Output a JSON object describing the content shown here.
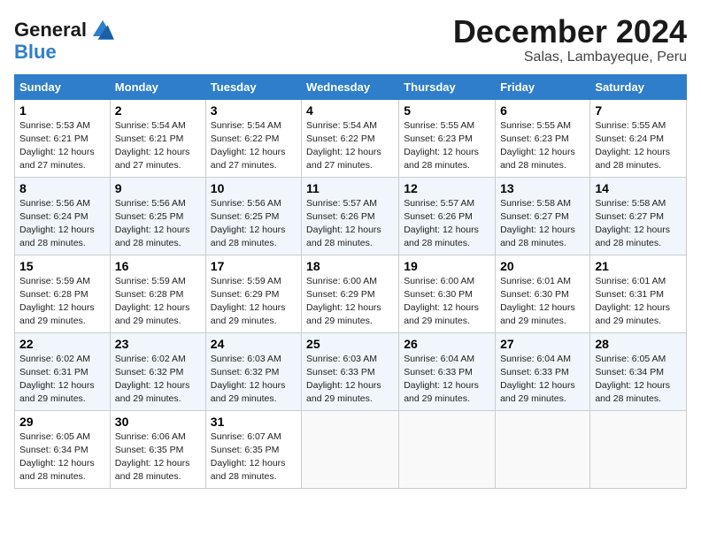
{
  "logo": {
    "line1": "General",
    "line2": "Blue"
  },
  "title": "December 2024",
  "location": "Salas, Lambayeque, Peru",
  "days_of_week": [
    "Sunday",
    "Monday",
    "Tuesday",
    "Wednesday",
    "Thursday",
    "Friday",
    "Saturday"
  ],
  "weeks": [
    [
      {
        "day": "1",
        "text": "Sunrise: 5:53 AM\nSunset: 6:21 PM\nDaylight: 12 hours\nand 27 minutes."
      },
      {
        "day": "2",
        "text": "Sunrise: 5:54 AM\nSunset: 6:21 PM\nDaylight: 12 hours\nand 27 minutes."
      },
      {
        "day": "3",
        "text": "Sunrise: 5:54 AM\nSunset: 6:22 PM\nDaylight: 12 hours\nand 27 minutes."
      },
      {
        "day": "4",
        "text": "Sunrise: 5:54 AM\nSunset: 6:22 PM\nDaylight: 12 hours\nand 27 minutes."
      },
      {
        "day": "5",
        "text": "Sunrise: 5:55 AM\nSunset: 6:23 PM\nDaylight: 12 hours\nand 28 minutes."
      },
      {
        "day": "6",
        "text": "Sunrise: 5:55 AM\nSunset: 6:23 PM\nDaylight: 12 hours\nand 28 minutes."
      },
      {
        "day": "7",
        "text": "Sunrise: 5:55 AM\nSunset: 6:24 PM\nDaylight: 12 hours\nand 28 minutes."
      }
    ],
    [
      {
        "day": "8",
        "text": "Sunrise: 5:56 AM\nSunset: 6:24 PM\nDaylight: 12 hours\nand 28 minutes."
      },
      {
        "day": "9",
        "text": "Sunrise: 5:56 AM\nSunset: 6:25 PM\nDaylight: 12 hours\nand 28 minutes."
      },
      {
        "day": "10",
        "text": "Sunrise: 5:56 AM\nSunset: 6:25 PM\nDaylight: 12 hours\nand 28 minutes."
      },
      {
        "day": "11",
        "text": "Sunrise: 5:57 AM\nSunset: 6:26 PM\nDaylight: 12 hours\nand 28 minutes."
      },
      {
        "day": "12",
        "text": "Sunrise: 5:57 AM\nSunset: 6:26 PM\nDaylight: 12 hours\nand 28 minutes."
      },
      {
        "day": "13",
        "text": "Sunrise: 5:58 AM\nSunset: 6:27 PM\nDaylight: 12 hours\nand 28 minutes."
      },
      {
        "day": "14",
        "text": "Sunrise: 5:58 AM\nSunset: 6:27 PM\nDaylight: 12 hours\nand 28 minutes."
      }
    ],
    [
      {
        "day": "15",
        "text": "Sunrise: 5:59 AM\nSunset: 6:28 PM\nDaylight: 12 hours\nand 29 minutes."
      },
      {
        "day": "16",
        "text": "Sunrise: 5:59 AM\nSunset: 6:28 PM\nDaylight: 12 hours\nand 29 minutes."
      },
      {
        "day": "17",
        "text": "Sunrise: 5:59 AM\nSunset: 6:29 PM\nDaylight: 12 hours\nand 29 minutes."
      },
      {
        "day": "18",
        "text": "Sunrise: 6:00 AM\nSunset: 6:29 PM\nDaylight: 12 hours\nand 29 minutes."
      },
      {
        "day": "19",
        "text": "Sunrise: 6:00 AM\nSunset: 6:30 PM\nDaylight: 12 hours\nand 29 minutes."
      },
      {
        "day": "20",
        "text": "Sunrise: 6:01 AM\nSunset: 6:30 PM\nDaylight: 12 hours\nand 29 minutes."
      },
      {
        "day": "21",
        "text": "Sunrise: 6:01 AM\nSunset: 6:31 PM\nDaylight: 12 hours\nand 29 minutes."
      }
    ],
    [
      {
        "day": "22",
        "text": "Sunrise: 6:02 AM\nSunset: 6:31 PM\nDaylight: 12 hours\nand 29 minutes."
      },
      {
        "day": "23",
        "text": "Sunrise: 6:02 AM\nSunset: 6:32 PM\nDaylight: 12 hours\nand 29 minutes."
      },
      {
        "day": "24",
        "text": "Sunrise: 6:03 AM\nSunset: 6:32 PM\nDaylight: 12 hours\nand 29 minutes."
      },
      {
        "day": "25",
        "text": "Sunrise: 6:03 AM\nSunset: 6:33 PM\nDaylight: 12 hours\nand 29 minutes."
      },
      {
        "day": "26",
        "text": "Sunrise: 6:04 AM\nSunset: 6:33 PM\nDaylight: 12 hours\nand 29 minutes."
      },
      {
        "day": "27",
        "text": "Sunrise: 6:04 AM\nSunset: 6:33 PM\nDaylight: 12 hours\nand 29 minutes."
      },
      {
        "day": "28",
        "text": "Sunrise: 6:05 AM\nSunset: 6:34 PM\nDaylight: 12 hours\nand 28 minutes."
      }
    ],
    [
      {
        "day": "29",
        "text": "Sunrise: 6:05 AM\nSunset: 6:34 PM\nDaylight: 12 hours\nand 28 minutes."
      },
      {
        "day": "30",
        "text": "Sunrise: 6:06 AM\nSunset: 6:35 PM\nDaylight: 12 hours\nand 28 minutes."
      },
      {
        "day": "31",
        "text": "Sunrise: 6:07 AM\nSunset: 6:35 PM\nDaylight: 12 hours\nand 28 minutes."
      },
      {
        "day": "",
        "text": ""
      },
      {
        "day": "",
        "text": ""
      },
      {
        "day": "",
        "text": ""
      },
      {
        "day": "",
        "text": ""
      }
    ]
  ]
}
